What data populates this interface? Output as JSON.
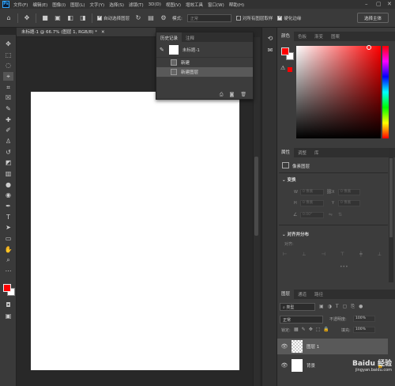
{
  "app": {
    "logo": "Ps"
  },
  "menu": [
    "文件(F)",
    "编辑(E)",
    "图像(I)",
    "图层(L)",
    "文字(Y)",
    "选择(S)",
    "滤镜(T)",
    "3D(D)",
    "视图(V)",
    "增效工具",
    "窗口(W)",
    "帮助(H)"
  ],
  "options": {
    "auto_select": "自动选择图层",
    "mode_label": "模式:",
    "mode_value": "正常",
    "sample_all": "对所有图层取样",
    "harden": "硬化边缘",
    "select_subject": "选择主体"
  },
  "document": {
    "tab_title": "未标题-1 @ 66.7% (图层 1, RGB/8) *"
  },
  "history": {
    "tabs": [
      "历史记录",
      "注释"
    ],
    "snapshot": "未标题-1",
    "items": [
      "新建",
      "新建图层"
    ]
  },
  "color_panel": {
    "tabs": [
      "颜色",
      "色板",
      "渐变",
      "图案"
    ],
    "fg": "#ff0000",
    "bg": "#ffffff"
  },
  "properties": {
    "tabs": [
      "属性",
      "调整",
      "库"
    ],
    "layer_type": "像素图层",
    "transform_title": "变换",
    "w": "W",
    "h": "H",
    "x": "X",
    "y": "Y",
    "w_val": "0 像素",
    "h_val": "0 像素",
    "x_val": "0 像素",
    "y_val": "0 像素",
    "angle": "0.00°",
    "align_title": "对齐并分布",
    "align_label": "对齐:"
  },
  "layers": {
    "tabs": [
      "图层",
      "通道",
      "路径"
    ],
    "filter": "类型",
    "blend": "正常",
    "opacity_label": "不透明度:",
    "opacity": "100%",
    "lock_label": "锁定:",
    "fill_label": "填充:",
    "fill": "100%",
    "items": [
      "图层 1",
      "背景"
    ]
  },
  "watermark": {
    "brand": "Baidu 经验",
    "url": "jingyan.baidu.com"
  }
}
